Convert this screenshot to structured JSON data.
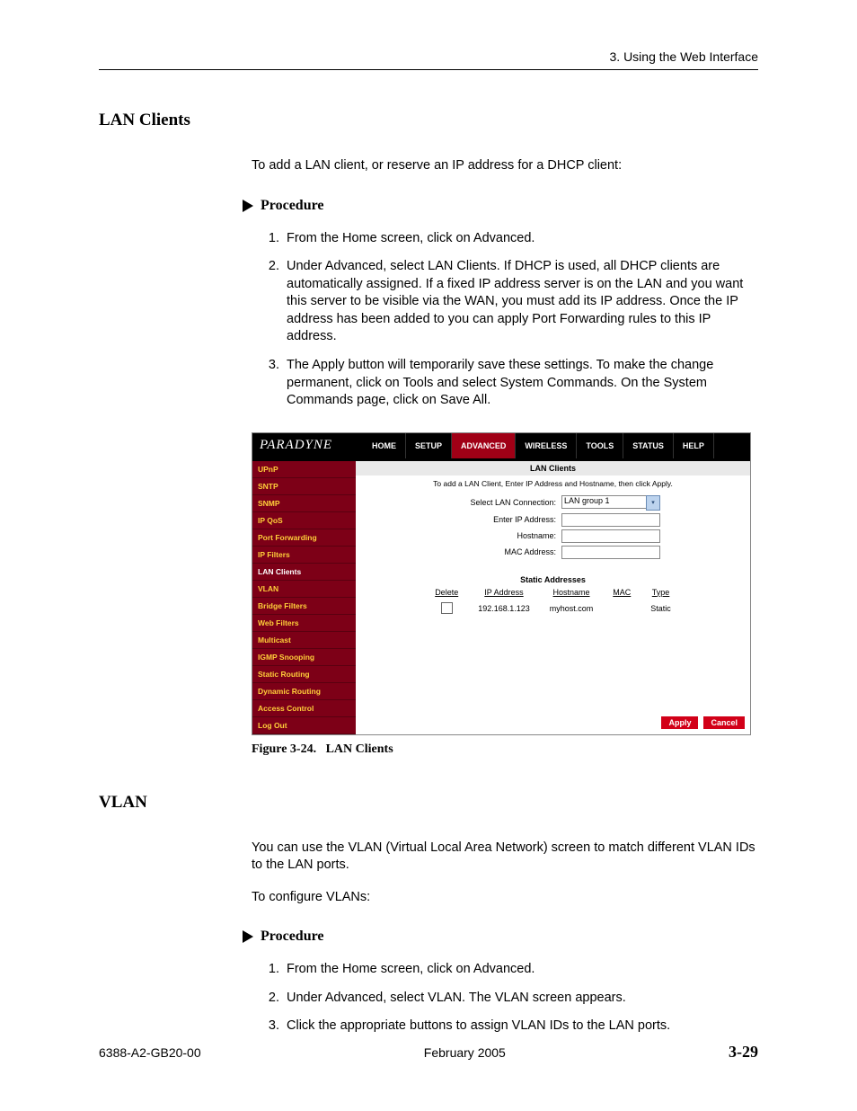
{
  "header": {
    "chapter": "3. Using the Web Interface"
  },
  "section1": {
    "heading": "LAN Clients",
    "intro": "To add a LAN client, or reserve an IP address for a DHCP client:",
    "procedure_label": "Procedure",
    "steps": {
      "s1": "From the Home screen, click on Advanced.",
      "s2": "Under Advanced, select LAN Clients. If DHCP is used, all DHCP clients are automatically assigned. If a fixed IP address server is on the LAN and you want this server to be visible via the WAN, you must add its IP address. Once the IP address has been added to you can apply Port Forwarding rules to this IP address.",
      "s3": "The Apply button will temporarily save these settings. To make the change permanent, click on Tools and select System Commands. On the System Commands page, click on Save All."
    }
  },
  "screenshot": {
    "brand": "PARADYNE",
    "topnav": [
      "HOME",
      "SETUP",
      "ADVANCED",
      "WIRELESS",
      "TOOLS",
      "STATUS",
      "HELP"
    ],
    "sidenav": [
      "UPnP",
      "SNTP",
      "SNMP",
      "IP QoS",
      "Port Forwarding",
      "IP Filters",
      "LAN Clients",
      "VLAN",
      "Bridge Filters",
      "Web Filters",
      "Multicast",
      "IGMP Snooping",
      "Static Routing",
      "Dynamic Routing",
      "Access Control",
      "Log Out"
    ],
    "pane_title": "LAN Clients",
    "pane_sub": "To add a LAN Client, Enter IP Address and Hostname, then click Apply.",
    "form": {
      "l1": "Select LAN Connection:",
      "v1": "LAN group 1",
      "l2": "Enter IP Address:",
      "l3": "Hostname:",
      "l4": "MAC Address:"
    },
    "static_title": "Static Addresses",
    "cols": {
      "c1": "Delete",
      "c2": "IP Address",
      "c3": "Hostname",
      "c4": "MAC",
      "c5": "Type"
    },
    "row": {
      "ip": "192.168.1.123",
      "host": "myhost.com",
      "mac": "",
      "type": "Static"
    },
    "btn_apply": "Apply",
    "btn_cancel": "Cancel"
  },
  "caption": {
    "num": "Figure 3-24.",
    "title": "LAN Clients"
  },
  "section2": {
    "heading": "VLAN",
    "para1": "You can use the VLAN (Virtual Local Area Network) screen to match different VLAN IDs to the LAN ports.",
    "para2": "To configure VLANs:",
    "procedure_label": "Procedure",
    "steps": {
      "s1": "From the Home screen, click on Advanced.",
      "s2": "Under Advanced, select VLAN. The VLAN screen appears.",
      "s3": "Click the appropriate buttons to assign VLAN IDs to the LAN ports."
    }
  },
  "footer": {
    "doc": "6388-A2-GB20-00",
    "date": "February 2005",
    "page": "3-29"
  }
}
